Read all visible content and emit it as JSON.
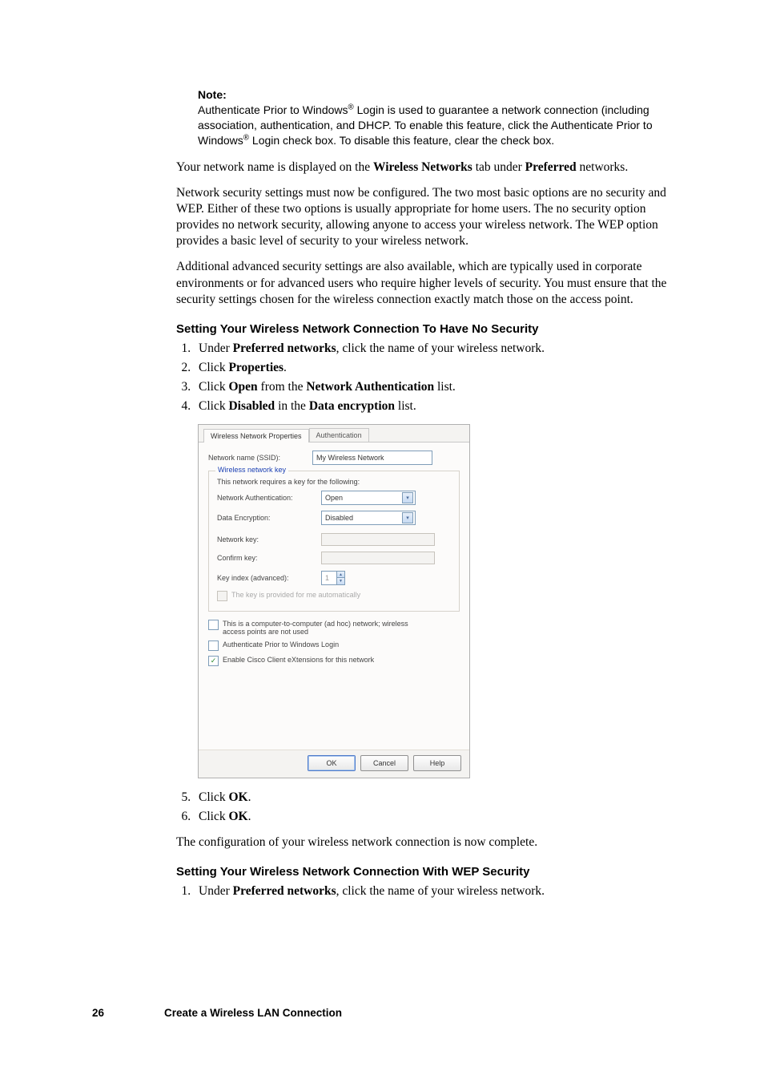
{
  "note": {
    "heading": "Note:",
    "line1a": "Authenticate Prior to Windows",
    "line1b": " Login is used to guarantee a network connection (including association, authentication, and DHCP. To enable this feature, click the Authenticate Prior to Windows",
    "line1c": " Login check box. To disable this feature, clear the check box."
  },
  "para1a": "Your network name is displayed on the ",
  "para1b": "Wireless Networks",
  "para1c": " tab under ",
  "para1d": "Preferred",
  "para1e": " networks.",
  "para2": "Network security settings must now be configured. The two most basic options are no security and WEP. Either of these two options is usually appropriate for home users. The no security option provides no network security, allowing anyone to access your wireless network. The WEP option provides a basic level of security to your wireless network.",
  "para3": "Additional advanced security settings are also available, which are typically used in corporate environments or for advanced users who require higher levels of security. You must ensure that the security settings chosen for the wireless connection exactly match those on the access point.",
  "heading1": "Setting Your Wireless Network Connection To Have No Security",
  "list1": {
    "i1a": "Under ",
    "i1b": "Preferred networks",
    "i1c": ", click the name of your wireless network.",
    "i2a": "Click ",
    "i2b": "Properties",
    "i2c": ".",
    "i3a": "Click ",
    "i3b": "Open",
    "i3c": " from the ",
    "i3d": "Network Authentication",
    "i3e": " list.",
    "i4a": "Click ",
    "i4b": "Disabled",
    "i4c": " in the ",
    "i4d": "Data encryption",
    "i4e": " list."
  },
  "dialog": {
    "tabs": {
      "t1": "Wireless Network Properties",
      "t2": "Authentication"
    },
    "ssid_label": "Network name (SSID):",
    "ssid_value": "My Wireless Network",
    "legend": "Wireless network key",
    "sub": "This network requires a key for the following:",
    "auth_label": "Network Authentication:",
    "auth_value": "Open",
    "enc_label": "Data Encryption:",
    "enc_value": "Disabled",
    "netkey_label": "Network key:",
    "confirm_label": "Confirm key:",
    "keyidx_label": "Key index (advanced):",
    "keyidx_value": "1",
    "auto_key": "The key is provided for me automatically",
    "adhoc": "This is a computer-to-computer (ad hoc) network; wireless access points are not used",
    "authprior": "Authenticate Prior to Windows Login",
    "cisco": "Enable Cisco Client eXtensions for this network",
    "ok": "OK",
    "cancel": "Cancel",
    "help": "Help"
  },
  "list2": {
    "i5a": "Click ",
    "i5b": "OK",
    "i5c": ".",
    "i6a": "Click ",
    "i6b": "OK",
    "i6c": "."
  },
  "para4": "The configuration of your wireless network connection is now complete.",
  "heading2": "Setting Your Wireless Network Connection With WEP Security",
  "list3": {
    "i1a": "Under ",
    "i1b": "Preferred networks",
    "i1c": ", click the name of your wireless network."
  },
  "footer": {
    "page": "26",
    "title": "Create a Wireless LAN Connection"
  },
  "reg": "®"
}
